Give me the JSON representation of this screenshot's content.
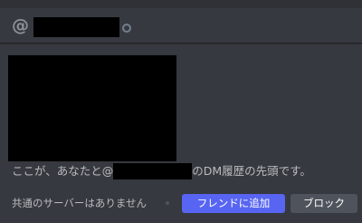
{
  "header": {
    "at_symbol": "@",
    "status": "offline"
  },
  "intro": {
    "before": "ここが、あなたと@",
    "after": "のDM履歴の先頭です。"
  },
  "footer": {
    "mutual_servers": "共通のサーバーはありません",
    "add_friend_label": "フレンドに追加",
    "block_label": "ブロック"
  },
  "colors": {
    "background": "#36393f",
    "accent": "#5865f2",
    "secondary_button": "#4f545c"
  }
}
